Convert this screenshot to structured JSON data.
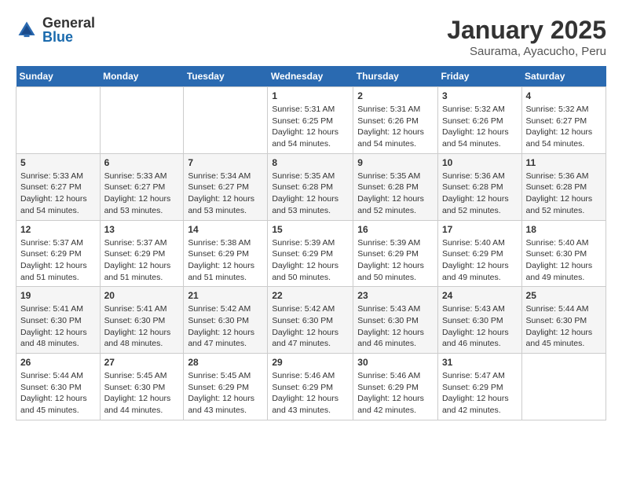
{
  "logo": {
    "general": "General",
    "blue": "Blue"
  },
  "title": "January 2025",
  "location": "Saurama, Ayacucho, Peru",
  "weekdays": [
    "Sunday",
    "Monday",
    "Tuesday",
    "Wednesday",
    "Thursday",
    "Friday",
    "Saturday"
  ],
  "weeks": [
    [
      {
        "day": "",
        "info": ""
      },
      {
        "day": "",
        "info": ""
      },
      {
        "day": "",
        "info": ""
      },
      {
        "day": "1",
        "info": "Sunrise: 5:31 AM\nSunset: 6:25 PM\nDaylight: 12 hours\nand 54 minutes."
      },
      {
        "day": "2",
        "info": "Sunrise: 5:31 AM\nSunset: 6:26 PM\nDaylight: 12 hours\nand 54 minutes."
      },
      {
        "day": "3",
        "info": "Sunrise: 5:32 AM\nSunset: 6:26 PM\nDaylight: 12 hours\nand 54 minutes."
      },
      {
        "day": "4",
        "info": "Sunrise: 5:32 AM\nSunset: 6:27 PM\nDaylight: 12 hours\nand 54 minutes."
      }
    ],
    [
      {
        "day": "5",
        "info": "Sunrise: 5:33 AM\nSunset: 6:27 PM\nDaylight: 12 hours\nand 54 minutes."
      },
      {
        "day": "6",
        "info": "Sunrise: 5:33 AM\nSunset: 6:27 PM\nDaylight: 12 hours\nand 53 minutes."
      },
      {
        "day": "7",
        "info": "Sunrise: 5:34 AM\nSunset: 6:27 PM\nDaylight: 12 hours\nand 53 minutes."
      },
      {
        "day": "8",
        "info": "Sunrise: 5:35 AM\nSunset: 6:28 PM\nDaylight: 12 hours\nand 53 minutes."
      },
      {
        "day": "9",
        "info": "Sunrise: 5:35 AM\nSunset: 6:28 PM\nDaylight: 12 hours\nand 52 minutes."
      },
      {
        "day": "10",
        "info": "Sunrise: 5:36 AM\nSunset: 6:28 PM\nDaylight: 12 hours\nand 52 minutes."
      },
      {
        "day": "11",
        "info": "Sunrise: 5:36 AM\nSunset: 6:28 PM\nDaylight: 12 hours\nand 52 minutes."
      }
    ],
    [
      {
        "day": "12",
        "info": "Sunrise: 5:37 AM\nSunset: 6:29 PM\nDaylight: 12 hours\nand 51 minutes."
      },
      {
        "day": "13",
        "info": "Sunrise: 5:37 AM\nSunset: 6:29 PM\nDaylight: 12 hours\nand 51 minutes."
      },
      {
        "day": "14",
        "info": "Sunrise: 5:38 AM\nSunset: 6:29 PM\nDaylight: 12 hours\nand 51 minutes."
      },
      {
        "day": "15",
        "info": "Sunrise: 5:39 AM\nSunset: 6:29 PM\nDaylight: 12 hours\nand 50 minutes."
      },
      {
        "day": "16",
        "info": "Sunrise: 5:39 AM\nSunset: 6:29 PM\nDaylight: 12 hours\nand 50 minutes."
      },
      {
        "day": "17",
        "info": "Sunrise: 5:40 AM\nSunset: 6:29 PM\nDaylight: 12 hours\nand 49 minutes."
      },
      {
        "day": "18",
        "info": "Sunrise: 5:40 AM\nSunset: 6:30 PM\nDaylight: 12 hours\nand 49 minutes."
      }
    ],
    [
      {
        "day": "19",
        "info": "Sunrise: 5:41 AM\nSunset: 6:30 PM\nDaylight: 12 hours\nand 48 minutes."
      },
      {
        "day": "20",
        "info": "Sunrise: 5:41 AM\nSunset: 6:30 PM\nDaylight: 12 hours\nand 48 minutes."
      },
      {
        "day": "21",
        "info": "Sunrise: 5:42 AM\nSunset: 6:30 PM\nDaylight: 12 hours\nand 47 minutes."
      },
      {
        "day": "22",
        "info": "Sunrise: 5:42 AM\nSunset: 6:30 PM\nDaylight: 12 hours\nand 47 minutes."
      },
      {
        "day": "23",
        "info": "Sunrise: 5:43 AM\nSunset: 6:30 PM\nDaylight: 12 hours\nand 46 minutes."
      },
      {
        "day": "24",
        "info": "Sunrise: 5:43 AM\nSunset: 6:30 PM\nDaylight: 12 hours\nand 46 minutes."
      },
      {
        "day": "25",
        "info": "Sunrise: 5:44 AM\nSunset: 6:30 PM\nDaylight: 12 hours\nand 45 minutes."
      }
    ],
    [
      {
        "day": "26",
        "info": "Sunrise: 5:44 AM\nSunset: 6:30 PM\nDaylight: 12 hours\nand 45 minutes."
      },
      {
        "day": "27",
        "info": "Sunrise: 5:45 AM\nSunset: 6:30 PM\nDaylight: 12 hours\nand 44 minutes."
      },
      {
        "day": "28",
        "info": "Sunrise: 5:45 AM\nSunset: 6:29 PM\nDaylight: 12 hours\nand 43 minutes."
      },
      {
        "day": "29",
        "info": "Sunrise: 5:46 AM\nSunset: 6:29 PM\nDaylight: 12 hours\nand 43 minutes."
      },
      {
        "day": "30",
        "info": "Sunrise: 5:46 AM\nSunset: 6:29 PM\nDaylight: 12 hours\nand 42 minutes."
      },
      {
        "day": "31",
        "info": "Sunrise: 5:47 AM\nSunset: 6:29 PM\nDaylight: 12 hours\nand 42 minutes."
      },
      {
        "day": "",
        "info": ""
      }
    ]
  ]
}
